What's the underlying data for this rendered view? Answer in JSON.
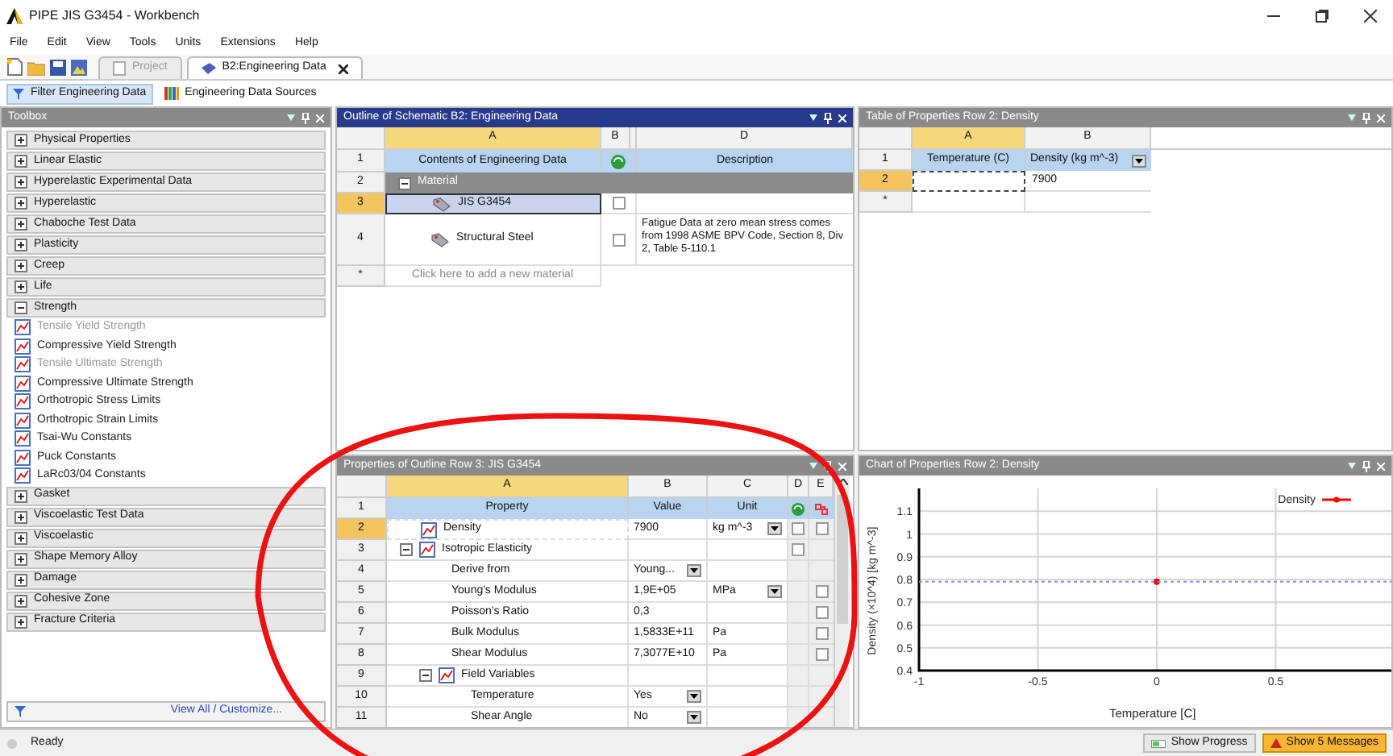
{
  "window": {
    "title": "PIPE JIS G3454 - Workbench"
  },
  "menu": [
    "File",
    "Edit",
    "View",
    "Tools",
    "Units",
    "Extensions",
    "Help"
  ],
  "tabs": [
    {
      "label": "Project",
      "selected": false
    },
    {
      "label": "B2:Engineering Data",
      "selected": true
    }
  ],
  "filter_bar": [
    {
      "label": "Filter Engineering Data",
      "selected": true
    },
    {
      "label": "Engineering Data Sources",
      "selected": false
    }
  ],
  "toolbox": {
    "title": "Toolbox",
    "groups": [
      {
        "label": "Physical Properties",
        "expanded": false
      },
      {
        "label": "Linear Elastic",
        "expanded": false
      },
      {
        "label": "Hyperelastic Experimental Data",
        "expanded": false
      },
      {
        "label": "Hyperelastic",
        "expanded": false
      },
      {
        "label": "Chaboche Test Data",
        "expanded": false
      },
      {
        "label": "Plasticity",
        "expanded": false
      },
      {
        "label": "Creep",
        "expanded": false
      },
      {
        "label": "Life",
        "expanded": false
      },
      {
        "label": "Strength",
        "expanded": true,
        "children": [
          {
            "label": "Tensile Yield Strength",
            "disabled": true
          },
          {
            "label": "Compressive Yield Strength",
            "disabled": false
          },
          {
            "label": "Tensile Ultimate Strength",
            "disabled": true
          },
          {
            "label": "Compressive Ultimate Strength",
            "disabled": false
          },
          {
            "label": "Orthotropic Stress Limits",
            "disabled": false
          },
          {
            "label": "Orthotropic Strain Limits",
            "disabled": false
          },
          {
            "label": "Tsai-Wu Constants",
            "disabled": false
          },
          {
            "label": "Puck Constants",
            "disabled": false
          },
          {
            "label": "LaRc03/04 Constants",
            "disabled": false
          }
        ]
      },
      {
        "label": "Gasket",
        "expanded": false
      },
      {
        "label": "Viscoelastic Test Data",
        "expanded": false
      },
      {
        "label": "Viscoelastic",
        "expanded": false
      },
      {
        "label": "Shape Memory Alloy",
        "expanded": false
      },
      {
        "label": "Damage",
        "expanded": false
      },
      {
        "label": "Cohesive Zone",
        "expanded": false
      },
      {
        "label": "Fracture Criteria",
        "expanded": false
      }
    ],
    "footer_link": "View All / Customize..."
  },
  "outline": {
    "title": "Outline of Schematic B2: Engineering Data",
    "active": true,
    "column_letters": [
      "A",
      "B",
      "D"
    ],
    "rows": [
      {
        "num": "1",
        "kind": "header",
        "cells": [
          "Contents of Engineering Data",
          "Description"
        ]
      },
      {
        "num": "2",
        "kind": "group",
        "label": "Material",
        "expanded": true
      },
      {
        "num": "3",
        "kind": "material",
        "name": "JIS G3454",
        "selected": true,
        "checked": false
      },
      {
        "num": "4",
        "kind": "material",
        "name": "Structural Steel",
        "selected": false,
        "checked": false,
        "description": "Fatigue Data at zero mean stress comes from 1998 ASME BPV Code, Section 8, Div 2, Table 5-110.1"
      },
      {
        "num": "*",
        "kind": "add",
        "label": "Click here to add a new material"
      }
    ]
  },
  "table_of_properties": {
    "title": "Table of Properties Row 2: Density",
    "active": false,
    "column_letters": [
      "A",
      "B"
    ],
    "header_num": "1",
    "headers": [
      "Temperature (C)",
      "Density (kg m^-3)"
    ],
    "rows": [
      {
        "num": "2",
        "selected": true,
        "density": "7900"
      },
      {
        "num": "*",
        "selected": false
      }
    ]
  },
  "properties": {
    "title": "Properties of Outline Row 3: JIS G3454",
    "active": false,
    "column_letters": [
      "A",
      "B",
      "C",
      "D",
      "E"
    ],
    "header_num": "1",
    "headers": [
      "Property",
      "Value",
      "Unit"
    ],
    "rows": [
      {
        "num": "2",
        "property": "Density",
        "icon": true,
        "selected": true,
        "value": "7900",
        "unit": "kg m^-3",
        "unit_dropdown": true,
        "d": {
          "checked": false
        },
        "e": {
          "checked": false
        }
      },
      {
        "num": "3",
        "property": "Isotropic Elasticity",
        "icon": true,
        "selected": false,
        "expanded": true,
        "d": {
          "checked": false
        },
        "children": [
          {
            "num": "4",
            "property": "Derive from",
            "selected": false,
            "value": "Young...",
            "value_dropdown": true
          },
          {
            "num": "5",
            "property": "Young's Modulus",
            "selected": false,
            "value": "1,9E+05",
            "unit": "MPa",
            "unit_dropdown": true,
            "e": {
              "checked": false
            }
          },
          {
            "num": "6",
            "property": "Poisson's Ratio",
            "selected": false,
            "value": "0,3",
            "e": {
              "checked": false
            }
          },
          {
            "num": "7",
            "property": "Bulk Modulus",
            "selected": false,
            "value": "1,5833E+11",
            "unit": "Pa",
            "e": {
              "checked": false
            }
          },
          {
            "num": "8",
            "property": "Shear Modulus",
            "selected": false,
            "value": "7,3077E+10",
            "unit": "Pa",
            "e": {
              "checked": false
            }
          },
          {
            "num": "9",
            "property": "Field Variables",
            "icon": true,
            "selected": false,
            "expanded": true,
            "children": [
              {
                "num": "10",
                "property": "Temperature",
                "selected": false,
                "value": "Yes",
                "value_dropdown": true
              },
              {
                "num": "11",
                "property": "Shear Angle",
                "selected": false,
                "value": "No",
                "value_dropdown": true
              }
            ]
          }
        ]
      }
    ]
  },
  "chart": {
    "title": "Chart of Properties Row 2: Density",
    "active": false,
    "chart_data": {
      "type": "line",
      "xlabel": "Temperature [C]",
      "ylabel": "Density (×10^4) [kg m^-3]",
      "x": [
        -1,
        0,
        1
      ],
      "series": [
        {
          "name": "Density",
          "color": "#ff0000",
          "marker": "o",
          "values": [
            null,
            0.79,
            null
          ]
        },
        {
          "color": "#8a8af0",
          "line_style": "dotted",
          "values": [
            0.79,
            0.79,
            0.79
          ]
        }
      ],
      "grid": true,
      "xlim": [
        -1,
        1
      ],
      "ylim": [
        0.4,
        1.2
      ],
      "xticks": [
        -1,
        -0.5,
        0,
        0.5
      ],
      "yticks": [
        {
          "value": 0.4,
          "label": "0.4"
        },
        {
          "value": 0.5,
          "label": "0.5"
        },
        {
          "value": 0.6,
          "label": "0.6"
        },
        {
          "value": 0.7,
          "label": "0.7"
        },
        {
          "value": 0.8,
          "label": "0.8"
        },
        {
          "value": 0.9,
          "label": "0.9"
        },
        {
          "value": 1,
          "label": "1"
        },
        {
          "value": 1.1,
          "label": "1.1"
        }
      ]
    }
  },
  "status_bar": {
    "text": "Ready",
    "buttons": [
      {
        "label": "Show Progress",
        "highlighted": false
      },
      {
        "label": "Show 5 Messages",
        "highlighted": true
      }
    ]
  }
}
